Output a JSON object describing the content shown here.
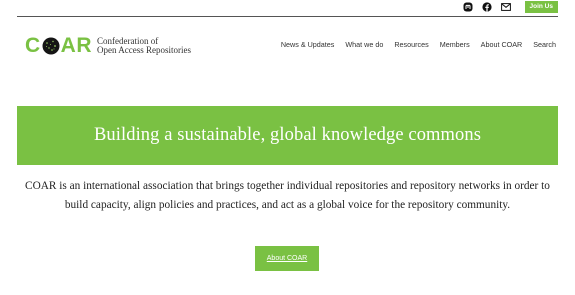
{
  "social": {
    "icons": [
      "mastodon-icon",
      "facebook-icon",
      "email-icon"
    ],
    "join_label": "Join Us"
  },
  "logo": {
    "wordmark_left": "C",
    "wordmark_right": "AR",
    "subtitle_line1": "Confederation of",
    "subtitle_line2": "Open Access Repositories"
  },
  "nav": {
    "items": [
      "News & Updates",
      "What we do",
      "Resources",
      "Members",
      "About COAR",
      "Search"
    ]
  },
  "hero": {
    "title": "Building a sustainable, global knowledge commons"
  },
  "intro": {
    "text": "COAR is an international association that brings together individual repositories and repository networks in order to build capacity, align policies and practices, and act as a global voice for the repository community."
  },
  "cta": {
    "label": "About COAR"
  },
  "colors": {
    "brand_green": "#7ac143",
    "text_dark": "#222222"
  }
}
